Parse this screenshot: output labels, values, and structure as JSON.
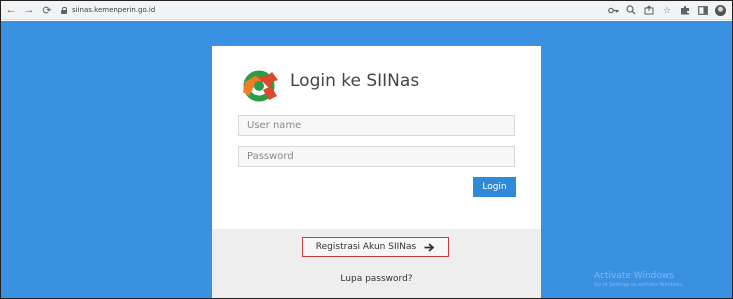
{
  "browser": {
    "url": "siinas.kemenperin.go.id"
  },
  "login": {
    "title": "Login ke SIINas",
    "username_placeholder": "User name",
    "password_placeholder": "Password",
    "login_label": "Login",
    "register_label": "Registrasi Akun SIINas",
    "forgot_label": "Lupa password?"
  },
  "watermark": {
    "title": "Activate Windows",
    "subtitle": "Go to Settings to activate Windows."
  },
  "colors": {
    "page_background": "#3a91e2",
    "button_primary": "#2f8bd8",
    "register_border": "#d03b3b",
    "logo_green": "#2e9b46",
    "logo_red": "#d94a2a",
    "logo_orange": "#ef7d2a"
  }
}
